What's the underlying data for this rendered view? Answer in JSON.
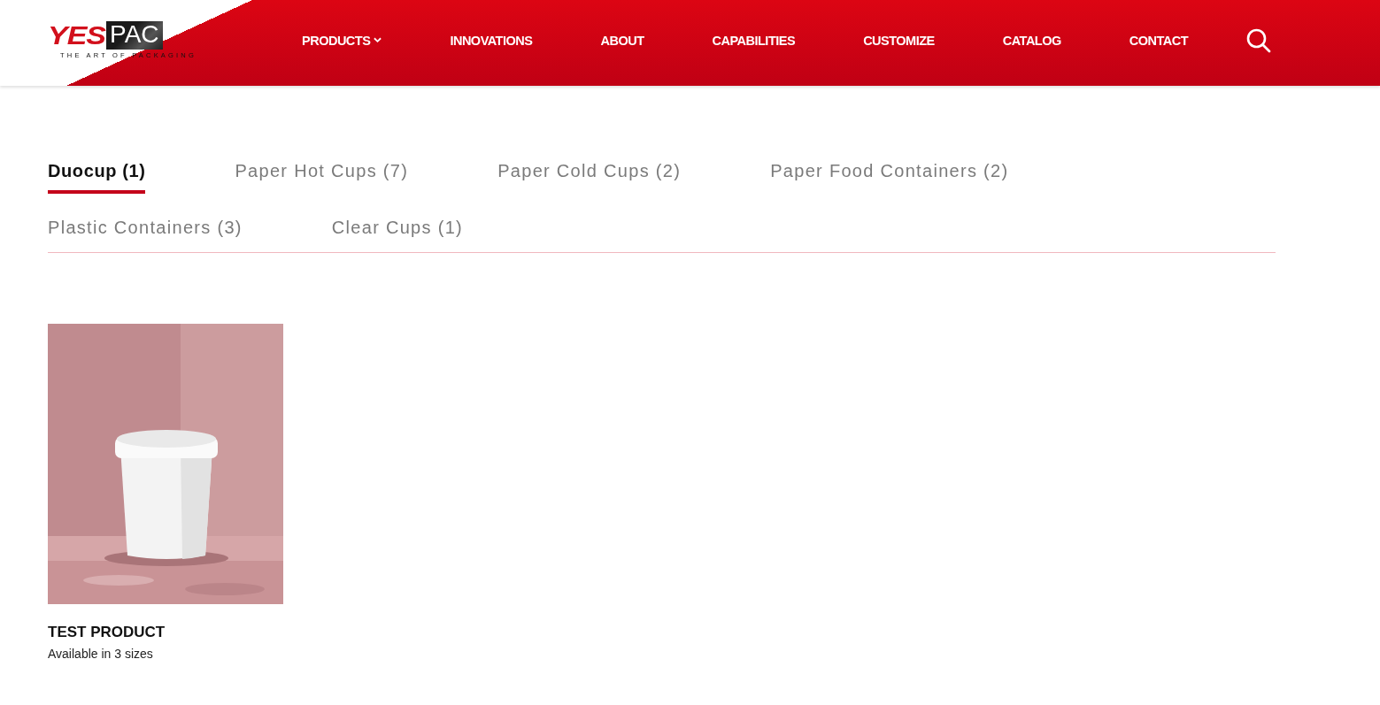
{
  "logo": {
    "brand_part_1": "YES",
    "brand_part_2": "PAC",
    "tagline": "THE ART OF PACKAGING"
  },
  "nav": [
    {
      "label": "PRODUCTS",
      "dropdown": true
    },
    {
      "label": "INNOVATIONS",
      "dropdown": false
    },
    {
      "label": "ABOUT",
      "dropdown": false
    },
    {
      "label": "CAPABILITIES",
      "dropdown": false
    },
    {
      "label": "CUSTOMIZE",
      "dropdown": false
    },
    {
      "label": "CATALOG",
      "dropdown": false
    },
    {
      "label": "CONTACT",
      "dropdown": false
    }
  ],
  "tabs": [
    {
      "label": "Duocup (1)",
      "selected": true
    },
    {
      "label": "Paper Hot Cups (7)",
      "selected": false
    },
    {
      "label": "Paper Cold Cups (2)",
      "selected": false
    },
    {
      "label": "Paper Food Containers (2)",
      "selected": false
    },
    {
      "label": "Plastic Containers (3)",
      "selected": false
    },
    {
      "label": "Clear Cups (1)",
      "selected": false
    }
  ],
  "products": [
    {
      "name": "TEST PRODUCT",
      "note": "Available in 3 sizes"
    }
  ]
}
